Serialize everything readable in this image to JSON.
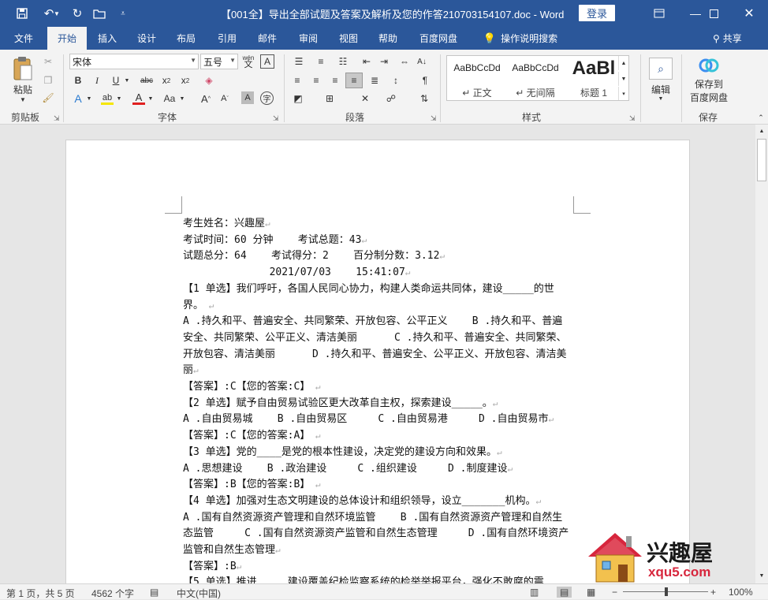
{
  "window": {
    "title": "【001全】导出全部试题及答案及解析及您的作答210703154107.doc  -  Word",
    "login_label": "登录"
  },
  "tabs": [
    "文件",
    "开始",
    "插入",
    "设计",
    "布局",
    "引用",
    "邮件",
    "审阅",
    "视图",
    "帮助",
    "百度网盘"
  ],
  "active_tab": "开始",
  "tell_me": "操作说明搜索",
  "share_label": "共享",
  "ribbon": {
    "clipboard": {
      "paste_label": "粘贴",
      "group_label": "剪贴板"
    },
    "font": {
      "font_name": "宋体",
      "font_size": "五号",
      "group_label": "字体",
      "phonetic_label": "wén"
    },
    "paragraph": {
      "group_label": "段落"
    },
    "styles": {
      "group_label": "样式",
      "items": [
        {
          "sample": "AaBbCcDd",
          "name": "↵ 正文"
        },
        {
          "sample": "AaBbCcDd",
          "name": "↵ 无间隔"
        },
        {
          "sample": "AaBl",
          "name": "标题 1"
        }
      ]
    },
    "editing": {
      "label": "编辑"
    },
    "save": {
      "label_line1": "保存到",
      "label_line2": "百度网盘",
      "group_label": "保存"
    }
  },
  "document": {
    "lines": [
      "考生姓名：兴趣屋",
      "考试时间：60 分钟    考试总题：43",
      "试题总分：64    考试得分：2    百分制分数：3.12",
      "              2021/07/03    15:41:07",
      "【1 单选】我们呼吁，各国人民同心协力，构建人类命运共同体，建设_____的世界。",
      "A .持久和平、普遍安全、共同繁荣、开放包容、公平正义    B .持久和平、普遍安全、共同繁荣、公平正义、清洁美丽      C .持久和平、普遍安全、共同繁荣、开放包容、清洁美丽      D .持久和平、普遍安全、公平正义、开放包容、清洁美丽",
      "【答案】:C【您的答案:C】",
      "【2 单选】赋予自由贸易试验区更大改革自主权，探索建设_____。",
      "A .自由贸易城    B .自由贸易区     C .自由贸易港     D .自由贸易市",
      "【答案】:C【您的答案:A】",
      "【3 单选】党的____是党的根本性建设，决定党的建设方向和效果。",
      "A .思想建设    B .政治建设     C .组织建设     D .制度建设",
      "【答案】:B【您的答案:B】",
      "【4 单选】加强对生态文明建设的总体设计和组织领导，设立_______机构。",
      "A .国有自然资源资产管理和自然环境监管    B .国有自然资源资产管理和自然生态监管     C .国有自然资源资产监管和自然生态管理     D .国有自然环境资产监管和自然生态管理",
      "【答案】:B",
      "【5 单选】推进_____建设覆盖纪检监察系统的检举举报平台，强化不敢腐的震"
    ]
  },
  "status": {
    "page": "第 1 页，共 5 页",
    "words": "4562 个字",
    "language": "中文(中国)",
    "zoom": "100%"
  },
  "watermark": {
    "name": "兴趣屋",
    "url": "xqu5.com"
  }
}
